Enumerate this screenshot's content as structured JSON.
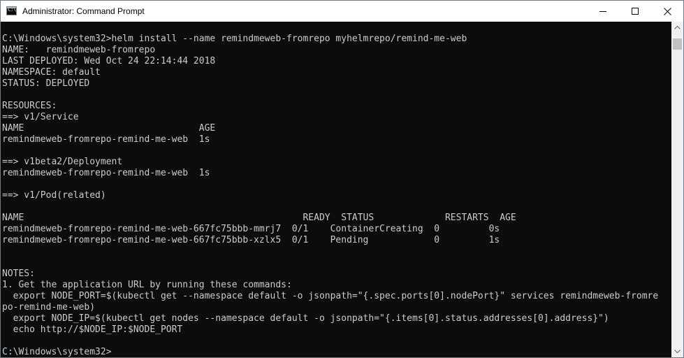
{
  "window": {
    "title": "Administrator: Command Prompt",
    "app_icon_glyph": "C:\\",
    "controls": {
      "minimize": "minimize-icon",
      "maximize": "maximize-icon",
      "close": "close-icon"
    }
  },
  "console": {
    "lines": [
      "C:\\Windows\\system32>helm install --name remindmeweb-fromrepo myhelmrepo/remind-me-web",
      "NAME:   remindmeweb-fromrepo",
      "LAST DEPLOYED: Wed Oct 24 22:14:44 2018",
      "NAMESPACE: default",
      "STATUS: DEPLOYED",
      "",
      "RESOURCES:",
      "==> v1/Service",
      "NAME                                AGE",
      "remindmeweb-fromrepo-remind-me-web  1s",
      "",
      "==> v1beta2/Deployment",
      "remindmeweb-fromrepo-remind-me-web  1s",
      "",
      "==> v1/Pod(related)",
      "",
      "NAME                                                   READY  STATUS             RESTARTS  AGE",
      "remindmeweb-fromrepo-remind-me-web-667fc75bbb-mmrj7  0/1    ContainerCreating  0         0s",
      "remindmeweb-fromrepo-remind-me-web-667fc75bbb-xzlx5  0/1    Pending            0         1s",
      "",
      "",
      "NOTES:",
      "1. Get the application URL by running these commands:",
      "  export NODE_PORT=$(kubectl get --namespace default -o jsonpath=\"{.spec.ports[0].nodePort}\" services remindmeweb-fromre",
      "po-remind-me-web)",
      "  export NODE_IP=$(kubectl get nodes --namespace default -o jsonpath=\"{.items[0].status.addresses[0].address}\")",
      "  echo http://$NODE_IP:$NODE_PORT",
      "",
      "C:\\Windows\\system32>"
    ]
  },
  "scrollbar": {
    "up_icon": "scroll-up-arrow-icon",
    "down_icon": "scroll-down-arrow-icon"
  },
  "colors": {
    "console_background": "#0c0c0c",
    "console_text": "#cccccc",
    "titlebar_background": "#ffffff"
  }
}
